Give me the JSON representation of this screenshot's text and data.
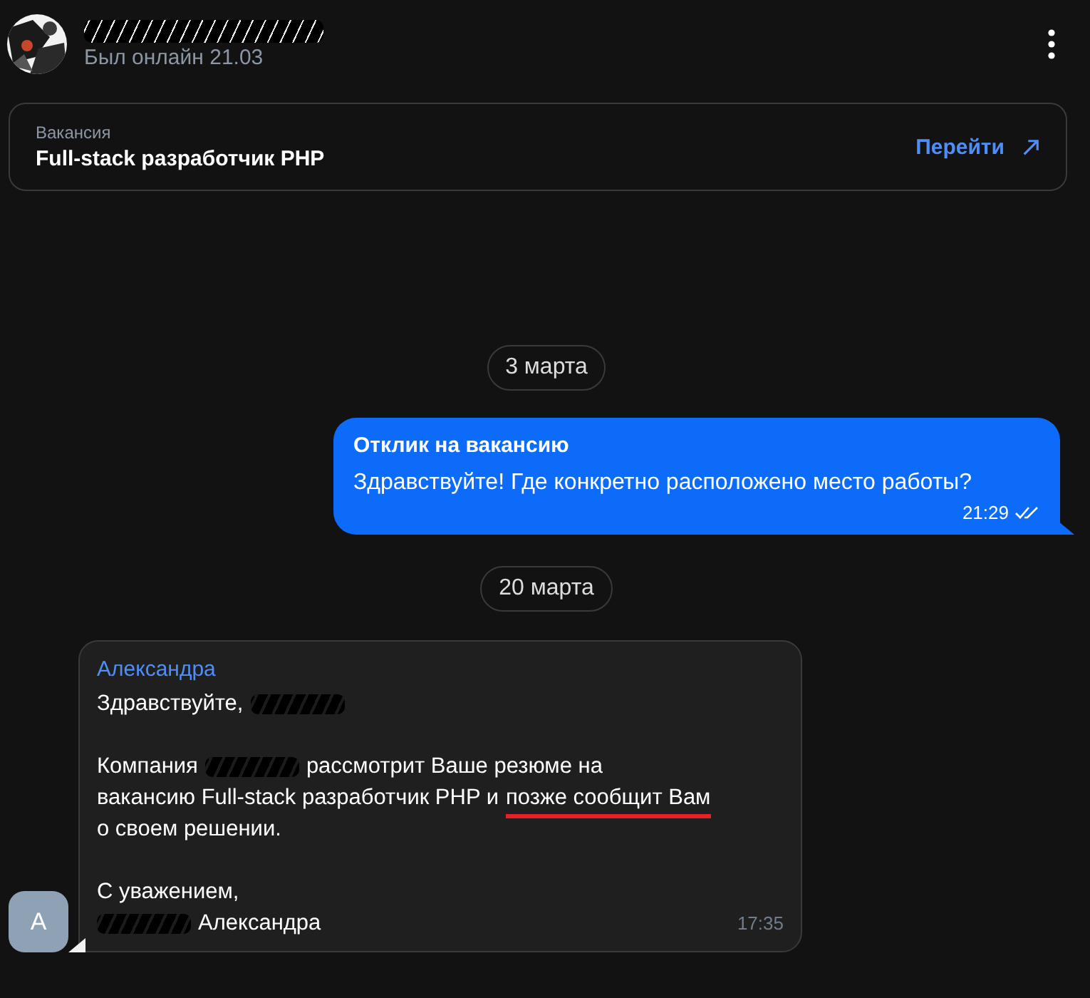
{
  "header": {
    "status": "Был онлайн 21.03"
  },
  "vacancy": {
    "label": "Вакансия",
    "title": "Full-stack разработчик PHP",
    "action": "Перейти"
  },
  "messages": [
    {
      "kind": "date",
      "text": "3 марта"
    },
    {
      "kind": "outgoing",
      "title": "Отклик на вакансию",
      "text": "Здравствуйте! Где конкретно расположено место работы?",
      "time": "21:29",
      "read": true
    },
    {
      "kind": "date",
      "text": "20 марта"
    },
    {
      "kind": "incoming",
      "author": "Александра",
      "avatar": "А",
      "time": "17:35",
      "paragraphs": [
        [
          [
            {
              "kind": "text",
              "text": "Здравствуйте,"
            },
            {
              "kind": "redacted"
            }
          ]
        ],
        [
          [
            {
              "kind": "text",
              "text": "Компания"
            },
            {
              "kind": "redacted"
            },
            {
              "kind": "text",
              "text": "рассмотрит Ваше резюме на"
            }
          ],
          [
            {
              "kind": "text",
              "text": "вакансию Full-stack разработчик PHP и"
            },
            {
              "kind": "text",
              "text": "позже сообщит Вам",
              "underline": true
            }
          ],
          [
            {
              "kind": "text",
              "text": "о своем решении."
            }
          ]
        ],
        [
          [
            {
              "kind": "text",
              "text": "С уважением,"
            }
          ],
          [
            {
              "kind": "redacted"
            },
            {
              "kind": "text",
              "text": "Александра"
            }
          ]
        ]
      ]
    }
  ]
}
